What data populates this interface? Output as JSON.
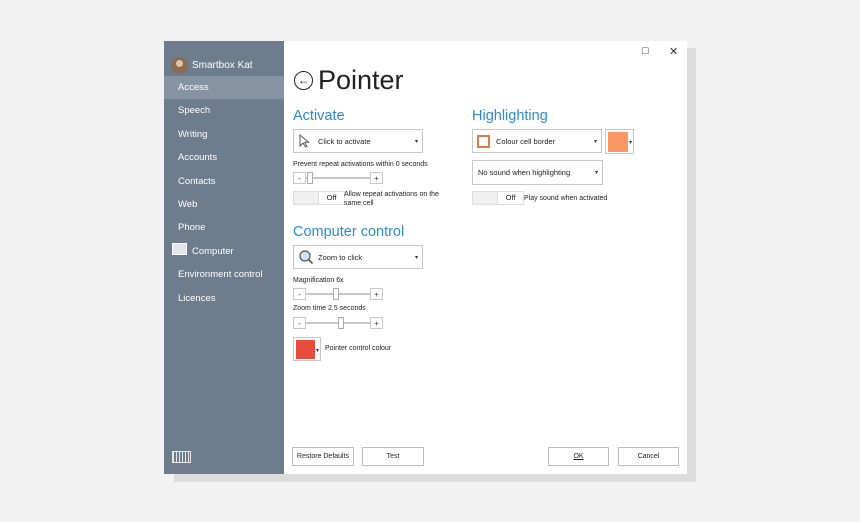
{
  "app": {
    "user_name": "Smartbox Kat",
    "window_controls": {
      "maximize": "□",
      "close": "✕"
    }
  },
  "sidebar": {
    "items": [
      {
        "label": "Access",
        "active": true
      },
      {
        "label": "Speech"
      },
      {
        "label": "Writing"
      },
      {
        "label": "Accounts"
      },
      {
        "label": "Contacts"
      },
      {
        "label": "Web"
      },
      {
        "label": "Phone"
      },
      {
        "label": "Computer",
        "icon": "monitor-icon"
      },
      {
        "label": "Environment control"
      },
      {
        "label": "Licences"
      }
    ],
    "keyboard_icon": "keyboard-icon"
  },
  "page": {
    "title": "Pointer",
    "back_icon": "back-arrow-icon"
  },
  "activate": {
    "heading": "Activate",
    "mode_value": "Click to activate",
    "mode_icon": "cursor-icon",
    "prevent_label": "Prevent repeat activations within 0 seconds",
    "prevent_value": 0,
    "minus": "-",
    "plus": "+",
    "allow_repeat_toggle": "Off",
    "allow_repeat_label": "Allow repeat activations on the same cell"
  },
  "computer_control": {
    "heading": "Computer control",
    "mode_value": "Zoom to click",
    "mode_icon": "magnifier-icon",
    "magnification_label": "Magnification 6x",
    "magnification_value": 6,
    "zoom_time_label": "Zoom time 2.5 seconds",
    "zoom_time_value": 2.5,
    "minus": "-",
    "plus": "+",
    "pointer_colour_label": "Pointer control colour",
    "pointer_colour": "#e74c3c"
  },
  "highlighting": {
    "heading": "Highlighting",
    "style_value": "Colour cell border",
    "border_colour": "#d97c4a",
    "swatch_colour": "#f79865",
    "sound_value": "No sound when highlighting",
    "play_sound_toggle": "Off",
    "play_sound_label": "Play sound when activated"
  },
  "footer": {
    "restore_label": "Restore Defaults",
    "test_label": "Test",
    "ok_label": "OK",
    "cancel_label": "Cancel"
  },
  "colors": {
    "accent": "#2e8bd1",
    "sidebar": "#6e7d8e",
    "sidebar_active": "#8593a3"
  }
}
